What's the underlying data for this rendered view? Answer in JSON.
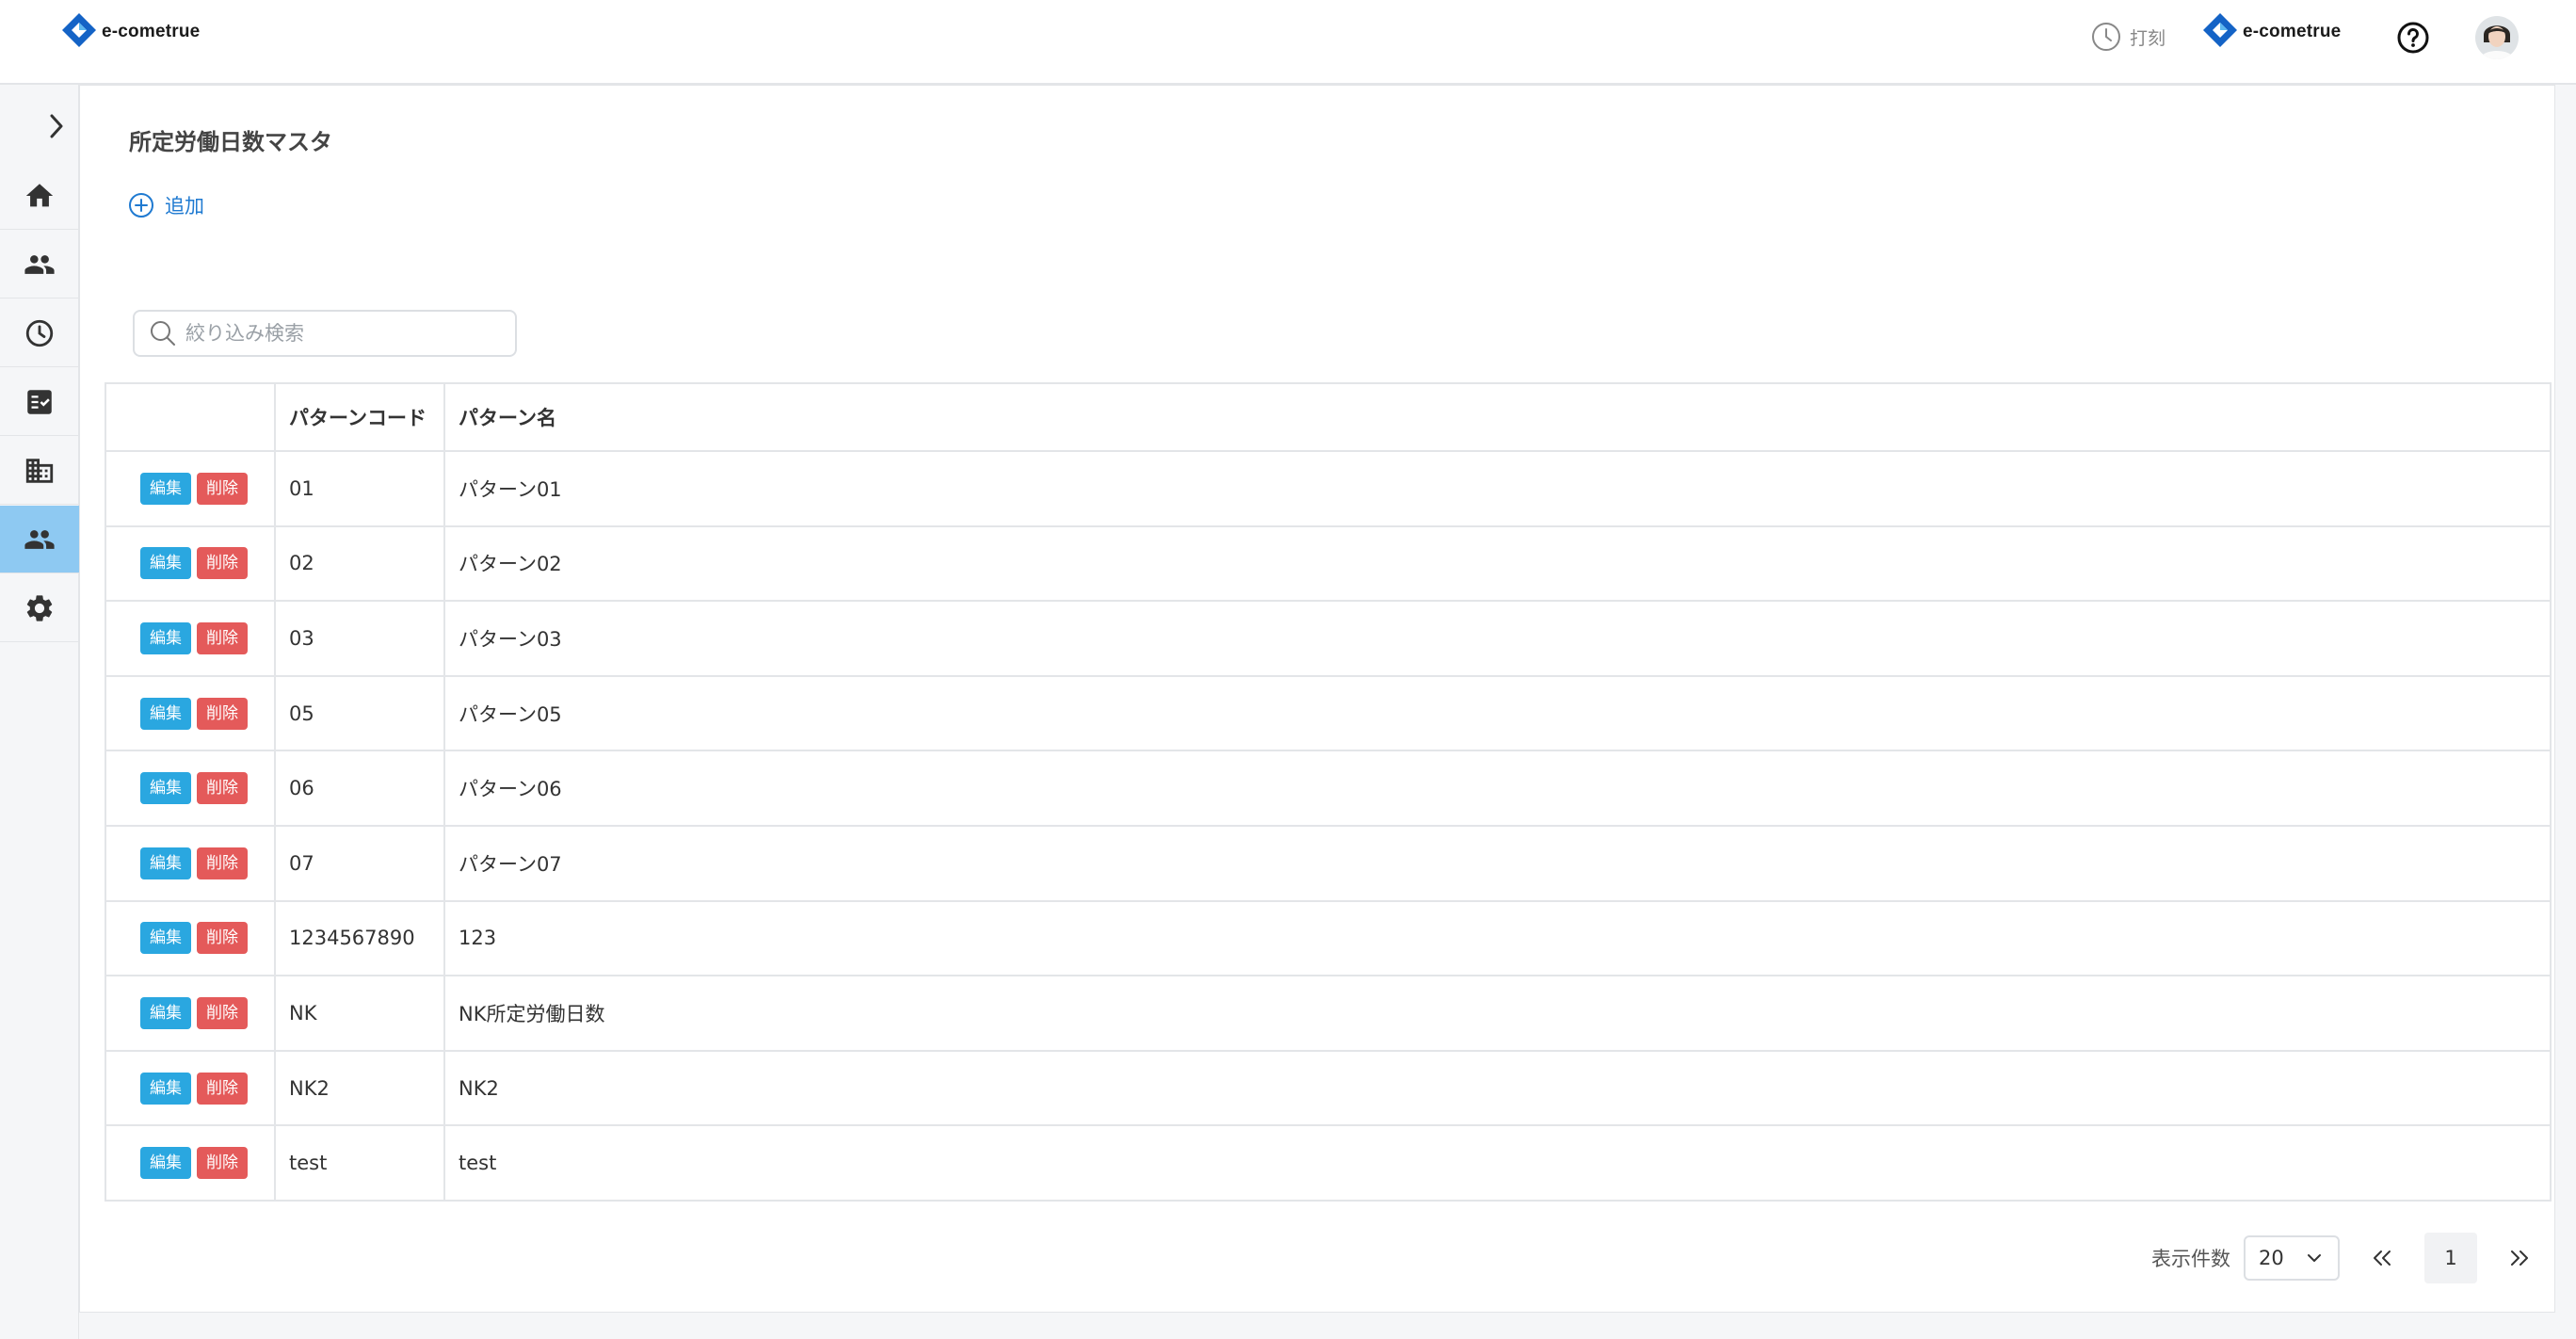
{
  "header": {
    "brand": "e-cometrue",
    "company_brand": "e-cometrue",
    "punch_label": "打刻"
  },
  "sidebar": {
    "items": [
      {
        "name": "home",
        "icon": "home-icon"
      },
      {
        "name": "users",
        "icon": "people-icon"
      },
      {
        "name": "attendance",
        "icon": "clock-icon"
      },
      {
        "name": "tasks",
        "icon": "checklist-icon"
      },
      {
        "name": "company",
        "icon": "building-icon"
      },
      {
        "name": "groups",
        "icon": "people-icon",
        "active": true
      },
      {
        "name": "settings",
        "icon": "gear-icon"
      }
    ]
  },
  "main": {
    "title": "所定労働日数マスタ",
    "add_label": "追加",
    "search_placeholder": "絞り込み検索",
    "table": {
      "headers": [
        "",
        "パターンコード",
        "パターン名"
      ],
      "edit_label": "編集",
      "delete_label": "削除",
      "rows": [
        {
          "code": "01",
          "name": "パターン01"
        },
        {
          "code": "02",
          "name": "パターン02"
        },
        {
          "code": "03",
          "name": "パターン03"
        },
        {
          "code": "05",
          "name": "パターン05"
        },
        {
          "code": "06",
          "name": "パターン06"
        },
        {
          "code": "07",
          "name": "パターン07"
        },
        {
          "code": "1234567890",
          "name": "123"
        },
        {
          "code": "NK",
          "name": "NK所定労働日数"
        },
        {
          "code": "NK2",
          "name": "NK2"
        },
        {
          "code": "test",
          "name": "test"
        }
      ]
    },
    "pagination": {
      "per_page_label": "表示件数",
      "per_page_value": "20",
      "current_page": "1"
    }
  },
  "colors": {
    "accent": "#1f7ad1",
    "edit_button": "#2aa7e0",
    "delete_button": "#e45a5a",
    "sidebar_active": "#8ec9f2"
  }
}
